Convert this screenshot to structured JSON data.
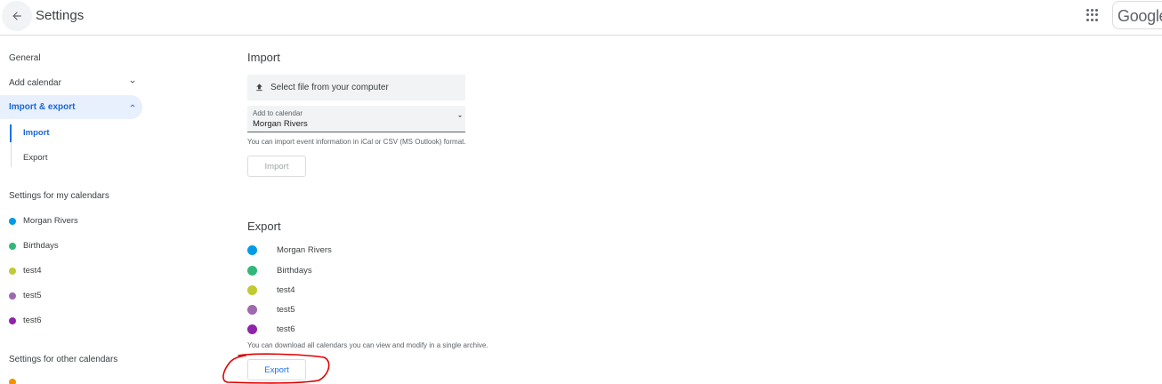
{
  "header": {
    "title": "Settings",
    "account_brand": "Google"
  },
  "sidebar": {
    "general": "General",
    "add_calendar": "Add calendar",
    "import_export": "Import & export",
    "sub_import": "Import",
    "sub_export": "Export",
    "my_calendars_heading": "Settings for my calendars",
    "my_calendars": [
      {
        "label": "Morgan Rivers",
        "color": "#039be5"
      },
      {
        "label": "Birthdays",
        "color": "#33b679"
      },
      {
        "label": "test4",
        "color": "#c0ca33"
      },
      {
        "label": "test5",
        "color": "#9e69af"
      },
      {
        "label": "test6",
        "color": "#8e24aa"
      }
    ],
    "other_calendars_heading": "Settings for other calendars",
    "other_calendar_color": "#f09300"
  },
  "import": {
    "heading": "Import",
    "file_button": "Select file from your computer",
    "select_label": "Add to calendar",
    "select_value": "Morgan Rivers",
    "hint": "You can import event information in iCal or CSV (MS Outlook) format.",
    "button": "Import"
  },
  "export": {
    "heading": "Export",
    "calendars": [
      {
        "label": "Morgan Rivers",
        "color": "#039be5"
      },
      {
        "label": "Birthdays",
        "color": "#33b679"
      },
      {
        "label": "test4",
        "color": "#c0ca33"
      },
      {
        "label": "test5",
        "color": "#9e69af"
      },
      {
        "label": "test6",
        "color": "#8e24aa"
      }
    ],
    "hint": "You can download all calendars you can view and modify in a single archive.",
    "button": "Export"
  },
  "colors": {
    "accent": "#1a73e8",
    "selected_bg": "#e8f0fe",
    "annotation": "#e00000"
  }
}
